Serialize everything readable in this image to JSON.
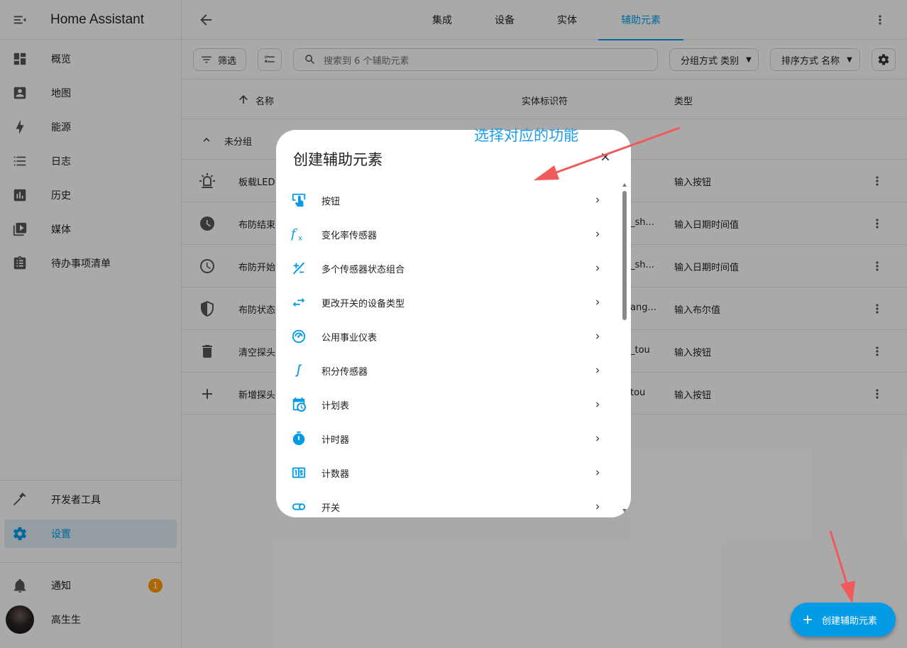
{
  "app": {
    "title": "Home Assistant"
  },
  "sidebar": {
    "items": [
      {
        "label": "概览",
        "icon": "dashboard-icon"
      },
      {
        "label": "地图",
        "icon": "map-account-icon"
      },
      {
        "label": "能源",
        "icon": "lightning-icon"
      },
      {
        "label": "日志",
        "icon": "format-list-icon"
      },
      {
        "label": "历史",
        "icon": "chart-box-icon"
      },
      {
        "label": "媒体",
        "icon": "play-box-icon"
      },
      {
        "label": "待办事项清单",
        "icon": "clipboard-list-icon"
      }
    ],
    "dev_tools": "开发者工具",
    "settings": "设置",
    "notifications": "通知",
    "notification_count": "1",
    "user": "高生生"
  },
  "tabs": [
    "集成",
    "设备",
    "实体",
    "辅助元素"
  ],
  "active_tab": "辅助元素",
  "toolbar": {
    "filter_label": "筛选",
    "search_placeholder": "搜索到 6 个辅助元素",
    "group_by": "分组方式 类别",
    "sort_by": "排序方式 名称"
  },
  "table": {
    "headers": {
      "name": "名称",
      "entity_id": "实体标识符",
      "type": "类型"
    },
    "group_label": "未分组",
    "rows": [
      {
        "name": "板载LED",
        "entity_id": "",
        "type": "输入按钮",
        "icon": "alarm-light-icon"
      },
      {
        "name": "布防结束",
        "entity_id": "_sh...",
        "type": "输入日期时间值",
        "icon": "clock-filled-icon"
      },
      {
        "name": "布防开始",
        "entity_id": "_sh...",
        "type": "输入日期时间值",
        "icon": "clock-outline-icon"
      },
      {
        "name": "布防状态",
        "entity_id": "ang...",
        "type": "输入布尔值",
        "icon": "shield-half-icon"
      },
      {
        "name": "清空探头",
        "entity_id": "_tou",
        "type": "输入按钮",
        "icon": "trash-icon"
      },
      {
        "name": "新增探头",
        "entity_id": "tou",
        "type": "输入按钮",
        "icon": "plus-icon"
      }
    ]
  },
  "dialog": {
    "title": "创建辅助元素",
    "items": [
      {
        "label": "按钮",
        "icon": "gesture-tap-button-icon"
      },
      {
        "label": "变化率传感器",
        "icon": "function-variant-icon"
      },
      {
        "label": "多个传感器状态组合",
        "icon": "plus-minus-icon"
      },
      {
        "label": "更改开关的设备类型",
        "icon": "swap-horizontal-icon"
      },
      {
        "label": "公用事业仪表",
        "icon": "gauge-icon"
      },
      {
        "label": "积分传感器",
        "icon": "integral-icon"
      },
      {
        "label": "计划表",
        "icon": "calendar-clock-icon"
      },
      {
        "label": "计时器",
        "icon": "timer-icon"
      },
      {
        "label": "计数器",
        "icon": "counter-icon"
      },
      {
        "label": "开关",
        "icon": "toggle-switch-icon"
      }
    ]
  },
  "fab": {
    "label": "创建辅助元素"
  },
  "annotation": {
    "text": "选择对应的功能"
  },
  "colors": {
    "accent": "#039be5",
    "badge": "#ff9800",
    "arrow": "#f05a5a"
  }
}
